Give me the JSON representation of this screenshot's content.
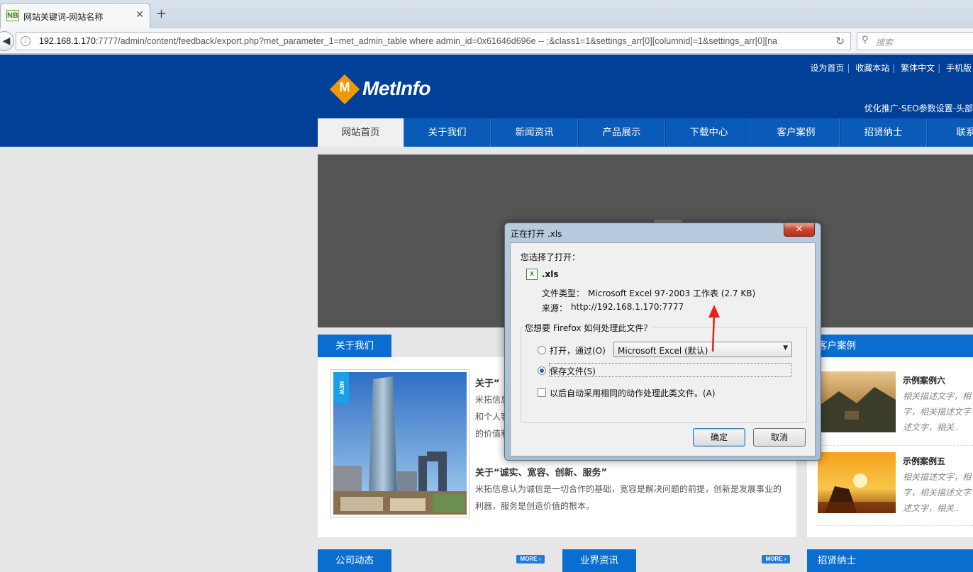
{
  "browser": {
    "tab_title": "网站关键词-网站名称",
    "favicon_text": "NB",
    "url_host": "192.168.1.170",
    "url_rest": ":7777/admin/content/feedback/export.php?met_parameter_1=met_admin_table where admin_id=0x61646d696e -- ;&class1=1&settings_arr[0][columnid]=1&settings_arr[0][na",
    "search_placeholder": "搜索"
  },
  "site": {
    "logo_text": "MetInfo",
    "logo_letter": "M",
    "top_links": [
      "设为首页",
      "收藏本站",
      "繁体中文",
      "手机版"
    ],
    "seo_text": "优化推广-SEO参数设置-头部",
    "nav": [
      "网站首页",
      "关于我们",
      "新闻资讯",
      "产品展示",
      "下载中心",
      "客户案例",
      "招贤纳士",
      "联系我"
    ]
  },
  "sections": {
    "about_tab": "关于我们",
    "cases_tab": "客户案例",
    "news_tab": "公司动态",
    "industry_tab": "业界资讯",
    "jobs_tab": "招贤纳士",
    "more": "MORE",
    "new_badge": "NEW"
  },
  "about": {
    "heading1": "关于“",
    "lines1": [
      "米拓信息",
      "和个人客",
      "的价值和"
    ],
    "heading2": "关于“诚实、宽容、创新、服务”",
    "para2_line1": "米拓信息认为诚信是一切合作的基础，宽容是解决问题的前提，创新是发展事业的",
    "para2_line2": "利器，服务是创造价值的根本。"
  },
  "cases": [
    {
      "title": "示例案例六",
      "desc_lines": [
        "相关描述文字，相",
        "字，相关描述文字",
        "述文字，相关.."
      ]
    },
    {
      "title": "示例案例五",
      "desc_lines": [
        "相关描述文字，相",
        "字，相关描述文字",
        "述文字，相关.."
      ]
    }
  ],
  "dialog": {
    "title": "正在打开 .xls",
    "close": "✕",
    "you_chose": "您选择了打开：",
    "filename": ".xls",
    "filetype_label": "文件类型：",
    "filetype_value": "Microsoft Excel 97-2003 工作表 (2.7 KB)",
    "source_label": "来源：",
    "source_value": "http://192.168.1.170:7777",
    "question": "您想要 Firefox 如何处理此文件？",
    "open_with": "打开，通过(O)",
    "open_with_app": "Microsoft Excel (默认)",
    "save_file": "保存文件(S)",
    "remember": "以后自动采用相同的动作处理此类文件。(A)",
    "ok": "确定",
    "cancel": "取消"
  },
  "colors": {
    "header_blue": "#004098",
    "nav_blue": "#0a5ab7",
    "logo_orange": "#f39800",
    "arrow_red": "#e8221a"
  }
}
